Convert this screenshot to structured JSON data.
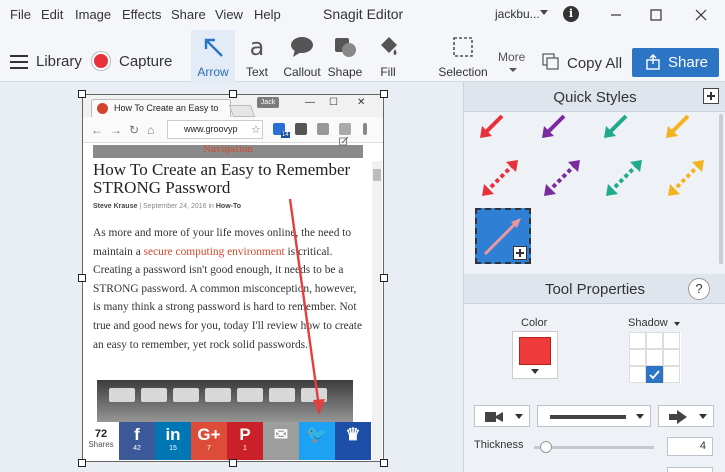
{
  "menu": [
    "File",
    "Edit",
    "Image",
    "Effects",
    "Share",
    "View",
    "Help"
  ],
  "app_title": "Snagit Editor",
  "account": "jackbu...",
  "toolbar": {
    "library": "Library",
    "capture": "Capture",
    "tools": [
      {
        "label": "Arrow",
        "icon": "arrow-icon",
        "active": true
      },
      {
        "label": "Text",
        "icon": "text-icon",
        "active": false
      },
      {
        "label": "Callout",
        "icon": "callout-icon",
        "active": false
      },
      {
        "label": "Shape",
        "icon": "shape-icon",
        "active": false
      },
      {
        "label": "Fill",
        "icon": "fill-bucket-icon",
        "active": false
      },
      {
        "label": "Selection",
        "icon": "selection-icon",
        "active": false
      }
    ],
    "more": "More",
    "copy_all": "Copy All",
    "share": "Share"
  },
  "capture": {
    "tab_title": "How To Create an Easy to",
    "profile": "Jack",
    "url": "www.groovyp",
    "extension_badge": "14",
    "nav_strip": "Navigation",
    "headline": "How To Create an Easy to Remember STRONG Password",
    "byline": {
      "author": "Steve Krause",
      "date": "September 24, 2016",
      "in": "in",
      "category": "How-To"
    },
    "paragraph_pre": "As more and more of your life moves online, the need to maintain a ",
    "paragraph_link": "secure computing environment",
    "paragraph_post": " is critical. Creating a password isn't good enough, it needs to be a STRONG password. A common misconception, however, is many think a strong password is hard to remember. Not true and good news for you, today I'll review how to create an easy to remember, yet rock solid passwords.",
    "share_count": "72",
    "share_label": "Shares",
    "social": [
      {
        "name": "facebook",
        "glyph": "f",
        "count": "42",
        "color": "#3b5998"
      },
      {
        "name": "linkedin",
        "glyph": "in",
        "count": "15",
        "color": "#0077b5"
      },
      {
        "name": "google-plus",
        "glyph": "G+",
        "count": "7",
        "color": "#dd4b39"
      },
      {
        "name": "pinterest",
        "glyph": "P",
        "count": "1",
        "color": "#cb2027"
      },
      {
        "name": "email",
        "glyph": "✉",
        "count": "",
        "color": "#9d9d9d"
      },
      {
        "name": "twitter",
        "glyph": "🐦",
        "count": "",
        "color": "#1da1f2"
      },
      {
        "name": "crown",
        "glyph": "♛",
        "count": "",
        "color": "#1e4fa8"
      }
    ]
  },
  "panel": {
    "quick_styles": "Quick Styles",
    "tool_properties": "Tool Properties",
    "help": "?",
    "color_label": "Color",
    "shadow_label": "Shadow",
    "thickness_label": "Thickness",
    "thickness_value": "4",
    "arrow_color": "#ef3b3b",
    "quick_style_colors": [
      "#e8313a",
      "#7b2aa0",
      "#1faa8c",
      "#f2b31f"
    ]
  },
  "colors": {
    "accent": "#2b75c4",
    "record": "#e8313a"
  }
}
